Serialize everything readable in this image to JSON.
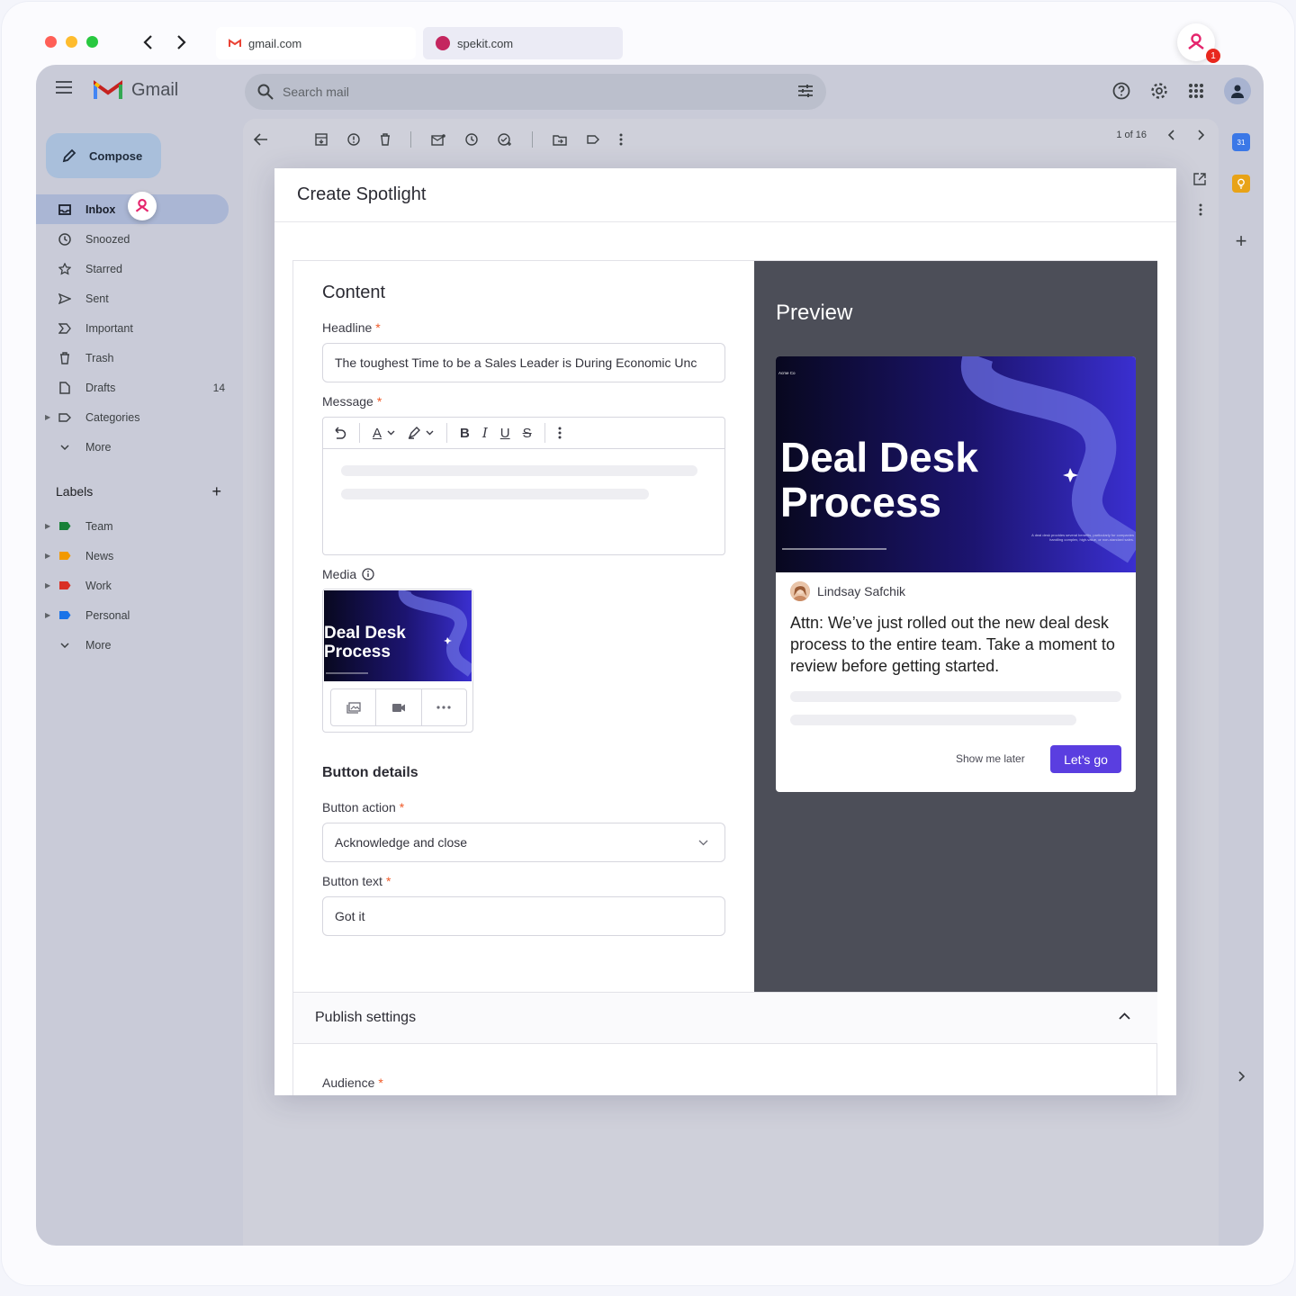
{
  "browser": {
    "tabs": [
      {
        "label": "gmail.com"
      },
      {
        "label": "spekit.com"
      }
    ],
    "notification_count": "1"
  },
  "gmail": {
    "app_name": "Gmail",
    "search_placeholder": "Search mail",
    "compose_label": "Compose",
    "folders": [
      {
        "label": "Inbox",
        "icon": "inbox-icon"
      },
      {
        "label": "Snoozed",
        "icon": "clock-icon"
      },
      {
        "label": "Starred",
        "icon": "star-icon"
      },
      {
        "label": "Sent",
        "icon": "send-icon"
      },
      {
        "label": "Important",
        "icon": "important-icon"
      },
      {
        "label": "Trash",
        "icon": "trash-icon"
      },
      {
        "label": "Drafts",
        "icon": "draft-icon",
        "count": "14"
      },
      {
        "label": "Categories",
        "icon": "label-icon"
      },
      {
        "label": "More",
        "icon": "chevron-down-icon"
      }
    ],
    "labels_title": "Labels",
    "labels": [
      {
        "label": "Team",
        "color": "#188038"
      },
      {
        "label": "News",
        "color": "#f29900"
      },
      {
        "label": "Work",
        "color": "#d93025"
      },
      {
        "label": "Personal",
        "color": "#1a73e8"
      }
    ],
    "labels_more": "More",
    "pager": "1 of 16"
  },
  "modal": {
    "title": "Create Spotlight",
    "content_title": "Content",
    "headline_label": "Headline",
    "headline_value": "The toughest Time to be a Sales Leader is During Economic Unc",
    "message_label": "Message",
    "media_label": "Media",
    "button_details_title": "Button details",
    "button_action_label": "Button action",
    "button_action_value": "Acknowledge and close",
    "button_text_label": "Button text",
    "button_text_value": "Got it",
    "publish_title": "Publish settings",
    "audience_label": "Audience",
    "required_mark": "*"
  },
  "preview": {
    "title": "Preview",
    "image_brand": "Acme Co",
    "image_title_line1": "Deal Desk",
    "image_title_line2": "Process",
    "image_caption": "A deal desk provides several benefits, particularly for companies handling complex, high-value, or non-standard sales.",
    "author": "Lindsay Safchik",
    "message": "Attn: We’ve just rolled out the new deal desk process to the entire team. Take a moment to review before getting started.",
    "later_label": "Show me later",
    "go_label": "Let’s go"
  },
  "colors": {
    "accent": "#5a3ee0",
    "spekit_pink": "#e5246c",
    "required": "#f05a28",
    "preview_bg": "#4c4e58"
  }
}
